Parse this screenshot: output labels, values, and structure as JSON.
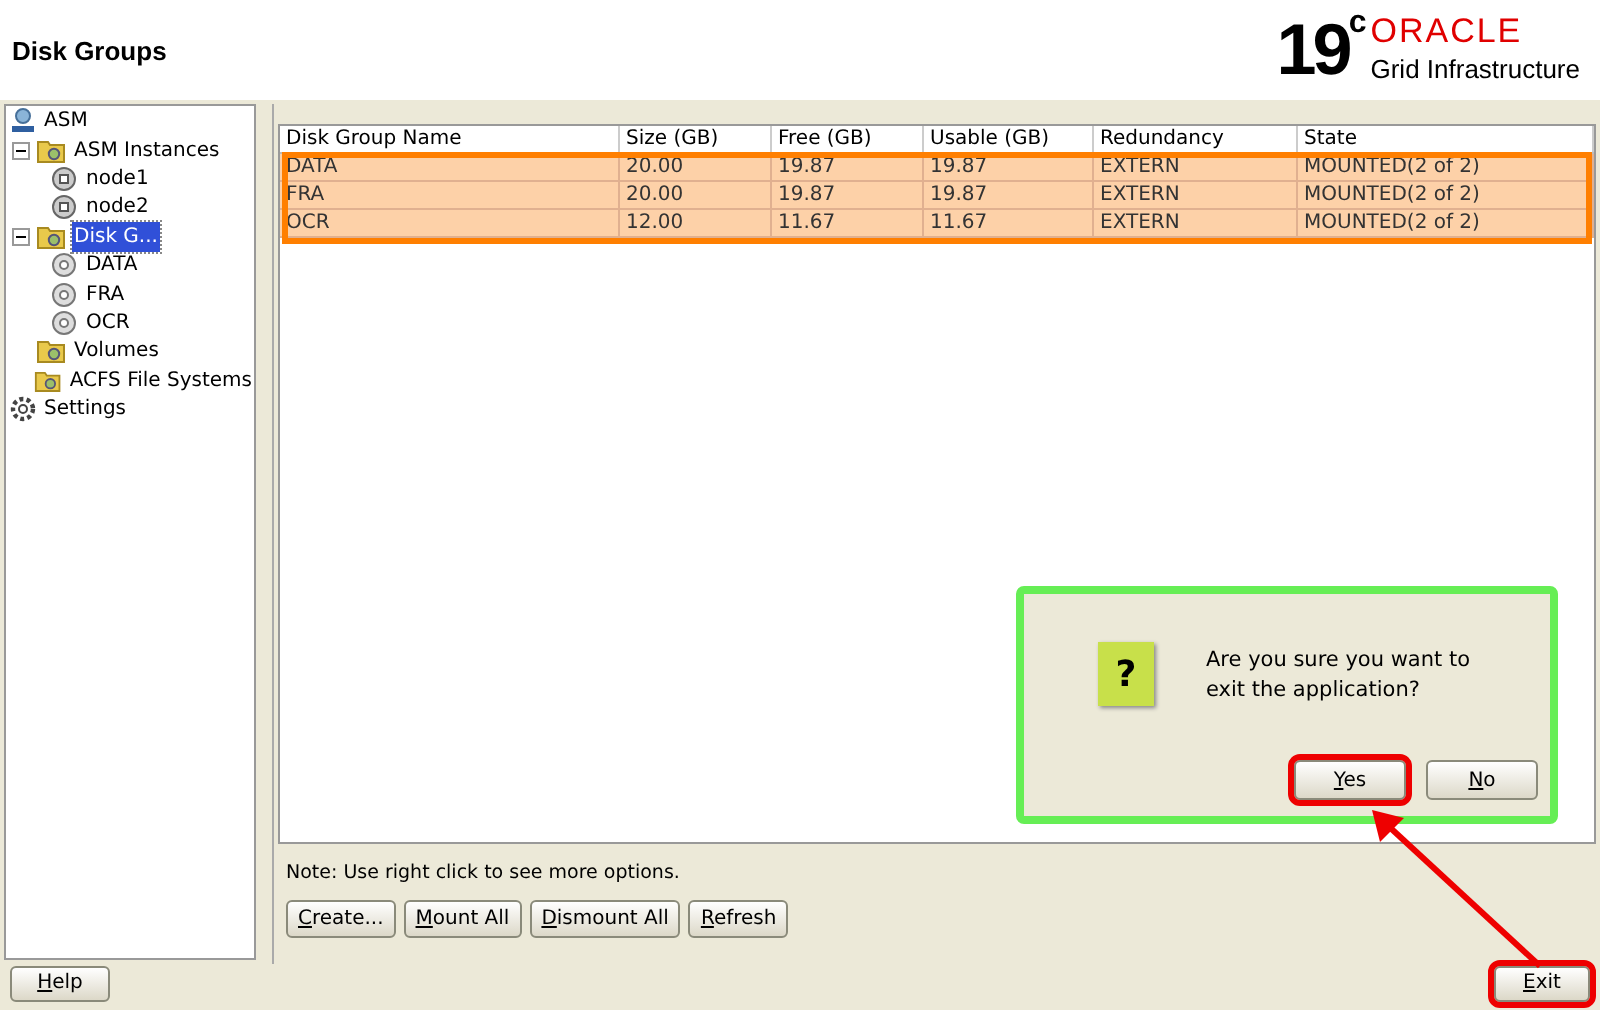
{
  "window": {
    "title": "Disk Groups"
  },
  "logo": {
    "version": "19",
    "version_sup": "c",
    "brand": "ORACLE",
    "product": "Grid Infrastructure"
  },
  "tree": [
    {
      "label": "ASM",
      "kind": "asm",
      "selected": false,
      "children": [
        {
          "label": "ASM Instances",
          "kind": "folder",
          "selected": false,
          "expanded": true,
          "children": [
            {
              "label": "node1",
              "kind": "node",
              "selected": false
            },
            {
              "label": "node2",
              "kind": "node",
              "selected": false
            }
          ]
        },
        {
          "label": "Disk G...",
          "kind": "folder",
          "selected": true,
          "expanded": true,
          "children": [
            {
              "label": "DATA",
              "kind": "disk",
              "selected": false
            },
            {
              "label": "FRA",
              "kind": "disk",
              "selected": false
            },
            {
              "label": "OCR",
              "kind": "disk",
              "selected": false
            }
          ]
        },
        {
          "label": "Volumes",
          "kind": "folder",
          "selected": false
        },
        {
          "label": "ACFS File Systems",
          "kind": "folder",
          "selected": false
        }
      ]
    },
    {
      "label": "Settings",
      "kind": "gear",
      "selected": false
    }
  ],
  "table": {
    "columns": [
      "Disk Group Name",
      "Size (GB)",
      "Free (GB)",
      "Usable (GB)",
      "Redundancy",
      "State"
    ],
    "annotated": true,
    "rows": [
      {
        "cells": [
          "DATA",
          "20.00",
          "19.87",
          "19.87",
          "EXTERN",
          "MOUNTED(2 of 2)"
        ],
        "selected": true
      },
      {
        "cells": [
          "FRA",
          "20.00",
          "19.87",
          "19.87",
          "EXTERN",
          "MOUNTED(2 of 2)"
        ],
        "selected": true
      },
      {
        "cells": [
          "OCR",
          "12.00",
          "11.67",
          "11.67",
          "EXTERN",
          "MOUNTED(2 of 2)"
        ],
        "selected": true
      }
    ]
  },
  "note": "Note: Use right click to see more options.",
  "actions": [
    "Create...",
    "Mount All",
    "Dismount All",
    "Refresh"
  ],
  "help_button": "Help",
  "exit_button": {
    "label": "Exit",
    "annotated": true
  },
  "dialog": {
    "icon": "?",
    "message": "Are you sure you want to exit the application?",
    "annotated": true,
    "buttons": [
      {
        "label": "Yes",
        "annotated": true
      },
      {
        "label": "No",
        "annotated": false
      }
    ]
  }
}
